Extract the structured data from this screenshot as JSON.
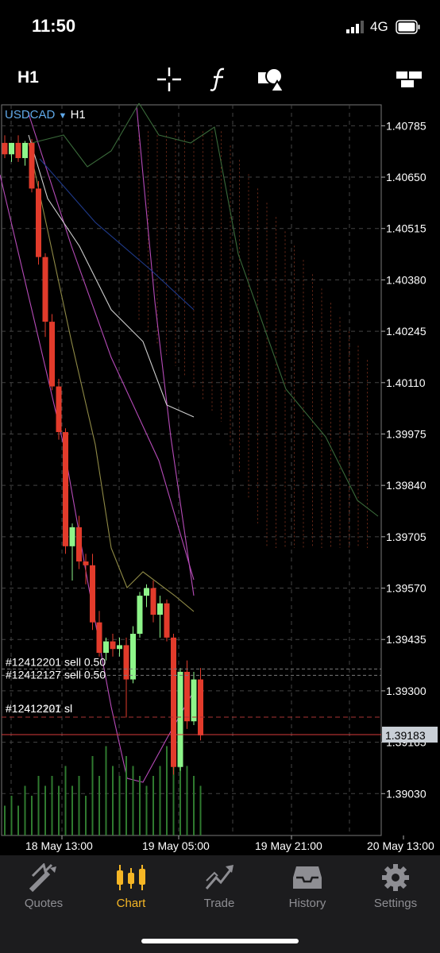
{
  "status_bar": {
    "time": "11:50",
    "network": "4G"
  },
  "toolbar": {
    "timeframe": "H1",
    "icons": [
      "crosshair-icon",
      "indicators-icon",
      "objects-icon",
      "window-layout-icon"
    ]
  },
  "chart": {
    "symbol": "USDCAD",
    "symbol_timeframe": "H1",
    "current_price": "1.39183",
    "price_levels": [
      "1.40785",
      "1.40650",
      "1.40515",
      "1.40380",
      "1.40245",
      "1.40110",
      "1.39975",
      "1.39840",
      "1.39705",
      "1.39570",
      "1.39435",
      "1.39300",
      "1.39165",
      "1.39030"
    ],
    "time_labels": [
      "18 May 13:00",
      "19 May 05:00",
      "19 May 21:00",
      "20 May 13:00"
    ],
    "order_labels": {
      "order1": "#12412201 sell 0.50",
      "order2": "#12412127 sell 0.50",
      "sl1": "#12412201 sl",
      "sl2": "#12412127 sl"
    },
    "colors": {
      "bull": "#8ef58a",
      "bear": "#e23b2b",
      "grid": "#444444",
      "price_line": "#d93a3a",
      "symbol": "#5fa8e8"
    }
  },
  "chart_data": {
    "type": "candlestick",
    "candles": [
      {
        "o": 1.4074,
        "h": 1.4076,
        "l": 1.407,
        "c": 1.4071
      },
      {
        "o": 1.4071,
        "h": 1.4074,
        "l": 1.4069,
        "c": 1.4074
      },
      {
        "o": 1.4074,
        "h": 1.4076,
        "l": 1.4069,
        "c": 1.407
      },
      {
        "o": 1.407,
        "h": 1.40745,
        "l": 1.4068,
        "c": 1.4074
      },
      {
        "o": 1.4074,
        "h": 1.4075,
        "l": 1.4061,
        "c": 1.4062
      },
      {
        "o": 1.4062,
        "h": 1.4064,
        "l": 1.4042,
        "c": 1.4044
      },
      {
        "o": 1.4044,
        "h": 1.4045,
        "l": 1.4023,
        "c": 1.4027
      },
      {
        "o": 1.4027,
        "h": 1.4029,
        "l": 1.4009,
        "c": 1.401
      },
      {
        "o": 1.401,
        "h": 1.4012,
        "l": 1.3996,
        "c": 1.3998
      },
      {
        "o": 1.3998,
        "h": 1.3999,
        "l": 1.3966,
        "c": 1.3968
      },
      {
        "o": 1.3968,
        "h": 1.3974,
        "l": 1.3959,
        "c": 1.3973
      },
      {
        "o": 1.3973,
        "h": 1.3976,
        "l": 1.3962,
        "c": 1.3964
      },
      {
        "o": 1.3964,
        "h": 1.3966,
        "l": 1.3958,
        "c": 1.3963
      },
      {
        "o": 1.3963,
        "h": 1.3966,
        "l": 1.3946,
        "c": 1.3948
      },
      {
        "o": 1.3948,
        "h": 1.3951,
        "l": 1.3939,
        "c": 1.394
      },
      {
        "o": 1.394,
        "h": 1.3944,
        "l": 1.3938,
        "c": 1.3943
      },
      {
        "o": 1.3943,
        "h": 1.3945,
        "l": 1.3939,
        "c": 1.3941
      },
      {
        "o": 1.3941,
        "h": 1.3944,
        "l": 1.3939,
        "c": 1.3942
      },
      {
        "o": 1.3942,
        "h": 1.3944,
        "l": 1.3923,
        "c": 1.3933
      },
      {
        "o": 1.3933,
        "h": 1.3947,
        "l": 1.3932,
        "c": 1.3945
      },
      {
        "o": 1.3945,
        "h": 1.3956,
        "l": 1.3944,
        "c": 1.3955
      },
      {
        "o": 1.3955,
        "h": 1.3958,
        "l": 1.3952,
        "c": 1.3957
      },
      {
        "o": 1.3957,
        "h": 1.3959,
        "l": 1.3948,
        "c": 1.395
      },
      {
        "o": 1.395,
        "h": 1.3955,
        "l": 1.3944,
        "c": 1.3953
      },
      {
        "o": 1.3953,
        "h": 1.3954,
        "l": 1.3943,
        "c": 1.3944
      },
      {
        "o": 1.3944,
        "h": 1.3945,
        "l": 1.3908,
        "c": 1.391
      },
      {
        "o": 1.391,
        "h": 1.3936,
        "l": 1.3909,
        "c": 1.3935
      },
      {
        "o": 1.3935,
        "h": 1.3938,
        "l": 1.392,
        "c": 1.3922
      },
      {
        "o": 1.3922,
        "h": 1.3935,
        "l": 1.3921,
        "c": 1.3933
      },
      {
        "o": 1.3933,
        "h": 1.3936,
        "l": 1.3917,
        "c": 1.39183
      }
    ],
    "volume": [
      3,
      4,
      3,
      5,
      4,
      6,
      5,
      6,
      5,
      7,
      5,
      6,
      4,
      8,
      6,
      9,
      7,
      6,
      8,
      7,
      6,
      5,
      6,
      7,
      9,
      10,
      8,
      7,
      6,
      5
    ],
    "ylim": [
      1.3892,
      1.4084
    ],
    "order_levels": [
      1.39345,
      1.39185
    ],
    "indicators": "Bollinger Bands, Ichimoku Cloud, Moving Averages, Volume"
  },
  "tabs": [
    {
      "label": "Quotes",
      "active": false
    },
    {
      "label": "Chart",
      "active": true
    },
    {
      "label": "Trade",
      "active": false
    },
    {
      "label": "History",
      "active": false
    },
    {
      "label": "Settings",
      "active": false
    }
  ]
}
